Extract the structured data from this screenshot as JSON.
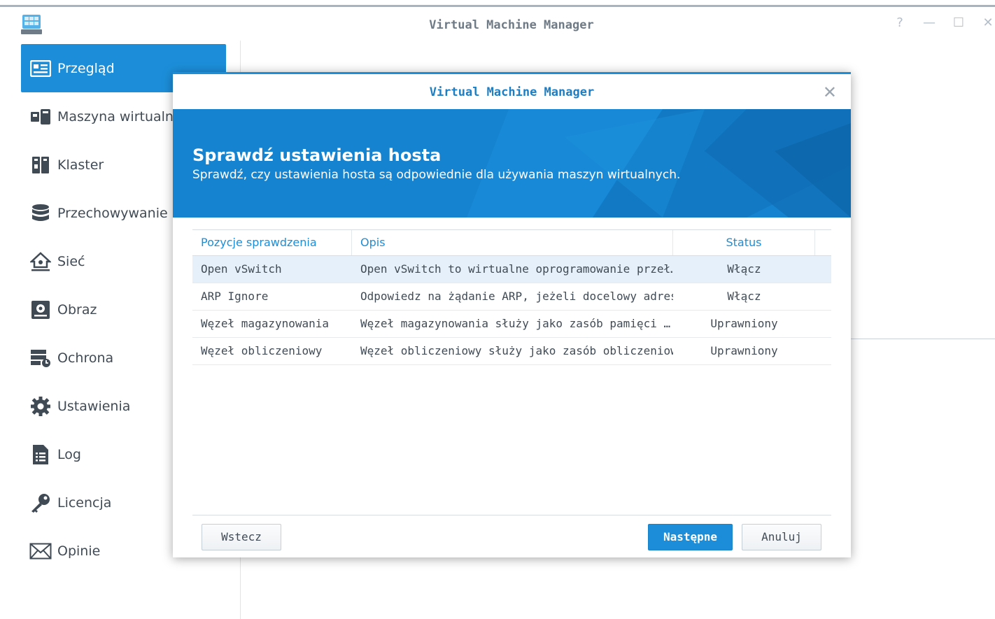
{
  "app": {
    "title": "Virtual Machine Manager",
    "help": "?",
    "minimize": "—",
    "maximize": "☐",
    "close": "✕"
  },
  "sidebar": {
    "items": [
      {
        "label": "Przegląd",
        "icon": "overview-icon",
        "active": true
      },
      {
        "label": "Maszyna wirtualna",
        "icon": "virtual-machine-icon"
      },
      {
        "label": "Klaster",
        "icon": "cluster-icon"
      },
      {
        "label": "Przechowywanie",
        "icon": "storage-icon"
      },
      {
        "label": "Sieć",
        "icon": "network-icon"
      },
      {
        "label": "Obraz",
        "icon": "image-icon"
      },
      {
        "label": "Ochrona",
        "icon": "protection-icon"
      },
      {
        "label": "Ustawienia",
        "icon": "settings-icon"
      },
      {
        "label": "Log",
        "icon": "log-icon"
      },
      {
        "label": "Licencja",
        "icon": "license-key-icon"
      },
      {
        "label": "Opinie",
        "icon": "feedback-mail-icon"
      }
    ]
  },
  "dialog": {
    "title": "Virtual Machine Manager",
    "close": "✕",
    "banner_title": "Sprawdź ustawienia hosta",
    "banner_subtitle": "Sprawdź, czy ustawienia hosta są odpowiednie dla używania maszyn wirtualnych.",
    "columns": [
      "Pozycje sprawdzenia",
      "Opis",
      "Status"
    ],
    "rows": [
      {
        "item": "Open vSwitch",
        "desc": "Open vSwitch to wirtualne oprogramowanie przeł…",
        "status": "Włącz",
        "selected": true
      },
      {
        "item": "ARP Ignore",
        "desc": "Odpowiedz na żądanie ARP, jeżeli docelowy adres…",
        "status": "Włącz"
      },
      {
        "item": "Węzeł magazynowania",
        "desc": "Węzeł magazynowania służy jako zasób pamięci …",
        "status": "Uprawniony"
      },
      {
        "item": "Węzeł obliczeniowy",
        "desc": "Węzeł obliczeniowy służy jako zasób obliczeniowy…",
        "status": "Uprawniony"
      }
    ],
    "buttons": {
      "back": "Wstecz",
      "next": "Następne",
      "cancel": "Anuluj"
    }
  },
  "colors": {
    "accent": "#1c8ed9",
    "banner": "#1583cf",
    "text": "#414b55"
  }
}
